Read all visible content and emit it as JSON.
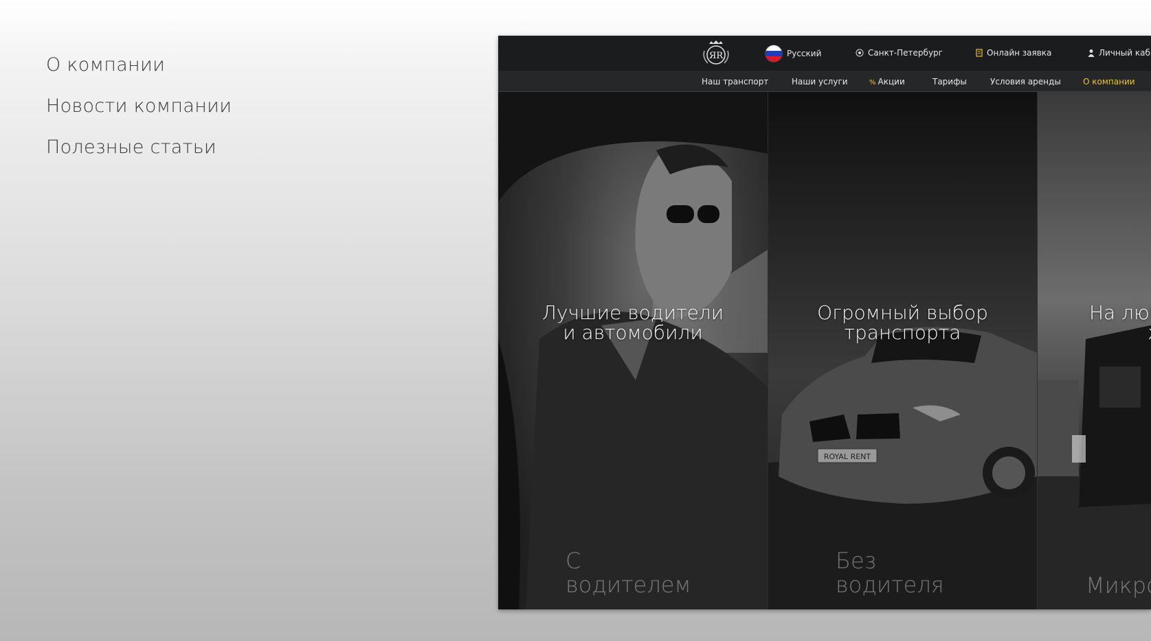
{
  "side_menu": {
    "items": [
      {
        "label": "О компании"
      },
      {
        "label": "Новости компании"
      },
      {
        "label": "Полезные статьи"
      }
    ]
  },
  "site": {
    "logo_text": "ЯR",
    "topbar": {
      "language": "Русский",
      "city": "Санкт-Петербург",
      "online_request": "Онлайн заявка",
      "cabinet": "Личный кабинет"
    },
    "nav": [
      {
        "label": "Наш транспорт"
      },
      {
        "label": "Наши услуги"
      },
      {
        "label": "Акции"
      },
      {
        "label": "Тарифы"
      },
      {
        "label": "Условия аренды"
      },
      {
        "label": "О компании"
      }
    ],
    "promo_icon": "%",
    "panels": [
      {
        "headline_1": "Лучшие водители",
        "headline_2": "и автомобили",
        "label_1": "С",
        "label_2": "водителем"
      },
      {
        "headline_1": "Огромный выбор",
        "headline_2": "транспорта",
        "label_1": "Без",
        "label_2": "водителя",
        "plate": "ROYAL RENT"
      },
      {
        "headline_1": "На любой",
        "headline_2": "жанр",
        "label_1": "Микроавтобусы",
        "label_2": ""
      }
    ],
    "colors": {
      "accent": "#f0c419",
      "bar": "#1b1c1e"
    }
  }
}
